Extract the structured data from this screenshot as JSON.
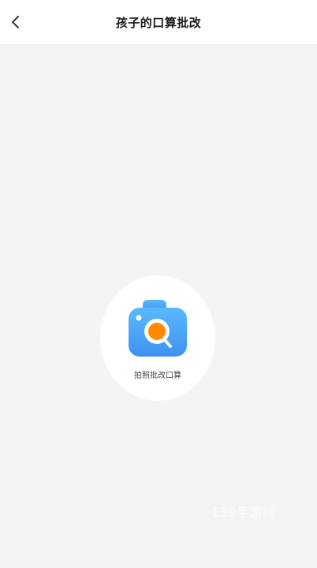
{
  "header": {
    "title": "孩子的口算批改",
    "back_icon": "chevron-left-icon"
  },
  "main": {
    "camera_button": {
      "label": "拍照批改口算",
      "icon": "camera-search-icon"
    }
  },
  "watermark": {
    "text": "139手游网"
  },
  "colors": {
    "header_bg": "#ffffff",
    "page_bg": "#f4f4f4",
    "camera_blue": "#4aa6f7",
    "camera_orange": "#ff8a00"
  }
}
